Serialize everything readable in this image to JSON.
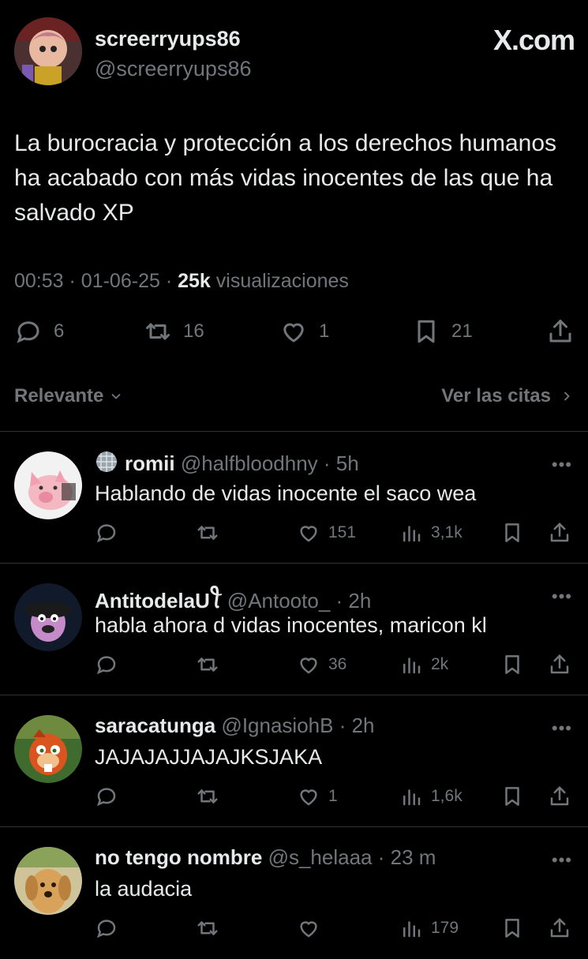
{
  "header": {
    "display_name": "screerryups86",
    "handle": "@screerryups86",
    "site_logo": "X.com"
  },
  "tweet": {
    "text": "La burocracia y protección a los derechos humanos ha acabado con más vidas inocentes de las que ha salvado XP",
    "time": "00:53",
    "date": "01-06-25",
    "views_count": "25k",
    "views_label": "visualizaciones",
    "replies": "6",
    "retweets": "16",
    "likes": "1",
    "bookmarks": "21"
  },
  "sort": {
    "label": "Relevante",
    "quotes_link": "Ver las citas"
  },
  "replies": [
    {
      "name": "romii",
      "handle": "@halfbloodhny",
      "time": "5h",
      "text": "Hablando de vidas inocente el saco wea",
      "likes": "151",
      "views": "3,1k"
    },
    {
      "name": "AntitodelaU",
      "name_suffix": "ꪻ",
      "handle": "@Antooto_",
      "time": "2h",
      "text": "habla ahora d vidas inocentes, maricon kl",
      "likes": "36",
      "views": "2k"
    },
    {
      "name": "saracatunga",
      "handle": "@IgnasiohB",
      "time": "2h",
      "text": "JAJAJAJJAJAJKSJAKA",
      "likes": "1",
      "views": "1,6k"
    },
    {
      "name": "no tengo nombre",
      "handle": "@s_helaaa",
      "time": "23 m",
      "text": "la audacia",
      "likes": "",
      "views": "179"
    }
  ],
  "colors": {
    "background": "#000000",
    "text": "#e7e9ea",
    "muted": "#71767b",
    "divider": "#2f3336"
  }
}
